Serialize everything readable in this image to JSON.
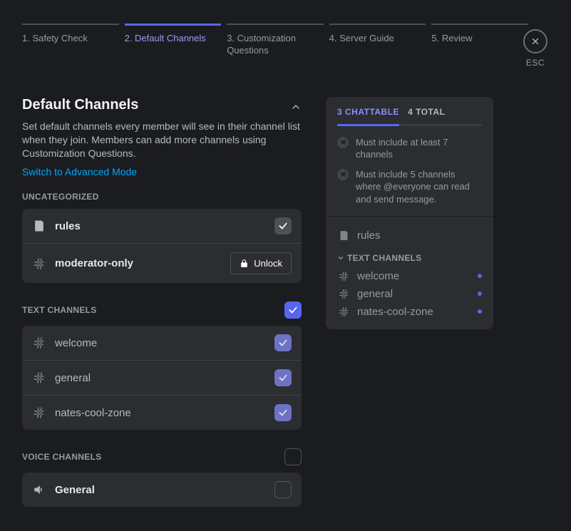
{
  "steps": [
    {
      "label": "1. Safety Check",
      "active": false
    },
    {
      "label": "2. Default Channels",
      "active": true
    },
    {
      "label": "3. Customization Questions",
      "active": false
    },
    {
      "label": "4. Server Guide",
      "active": false
    },
    {
      "label": "5. Review",
      "active": false
    }
  ],
  "close_label": "ESC",
  "section": {
    "title": "Default Channels",
    "desc": "Set default channels every member will see in their channel list when they join. Members can add more channels using Customization Questions.",
    "advanced": "Switch to Advanced Mode"
  },
  "categories": {
    "uncategorized": {
      "label": "UNCATEGORIZED",
      "items": [
        {
          "name": "rules",
          "type": "rules",
          "state": "checked-dark"
        },
        {
          "name": "moderator-only",
          "type": "text",
          "state": "locked"
        }
      ]
    },
    "text": {
      "label": "TEXT CHANNELS",
      "header_check": "checked-accent",
      "items": [
        {
          "name": "welcome",
          "type": "text",
          "state": "checked-muted"
        },
        {
          "name": "general",
          "type": "text",
          "state": "checked-muted"
        },
        {
          "name": "nates-cool-zone",
          "type": "text",
          "state": "checked-muted"
        }
      ]
    },
    "voice": {
      "label": "VOICE CHANNELS",
      "header_check": "unchecked",
      "items": [
        {
          "name": "General",
          "type": "voice",
          "state": "unchecked"
        }
      ]
    }
  },
  "unlock_label": "Unlock",
  "summary": {
    "chattable_count": "3 CHATTABLE",
    "total_count": "4 TOTAL",
    "reqs": [
      "Must include at least 7 channels",
      "Must include 5 channels where @everyone can read and send message."
    ],
    "rules": "rules",
    "text_label": "TEXT CHANNELS",
    "channels": [
      "welcome",
      "general",
      "nates-cool-zone"
    ]
  }
}
